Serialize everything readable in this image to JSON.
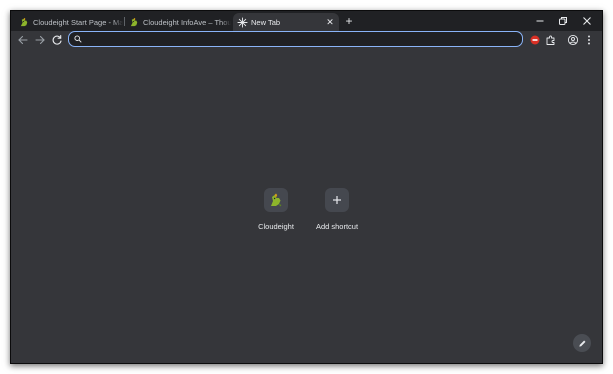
{
  "browser": {
    "tabs": [
      {
        "title": "Cloudeight Start Page - Make Cloudeight your start page",
        "favicon": "cloudeight-dog-icon",
        "active": false
      },
      {
        "title": "Cloudeight InfoAve – Thousands of tips and tricks",
        "favicon": "cloudeight-dog-icon",
        "active": false
      },
      {
        "title": "New Tab",
        "favicon": "new-tab-icon",
        "active": true
      }
    ],
    "new_tab_symbol": "+",
    "close_symbol": "✕"
  },
  "toolbar": {
    "omnibox": {
      "value": "",
      "placeholder": ""
    }
  },
  "new_tab_page": {
    "shortcuts": [
      {
        "label": "Cloudeight",
        "icon": "cloudeight-dog-icon"
      },
      {
        "label": "Add shortcut",
        "icon": "plus-icon",
        "symbol": "+"
      }
    ],
    "customize_icon": "pencil-icon"
  },
  "colors": {
    "frame": "#202124",
    "toolbar": "#35363a",
    "omnibox_focus": "#8ab4f8",
    "text": "#e8eaed",
    "extension_badge": "#d93025"
  }
}
